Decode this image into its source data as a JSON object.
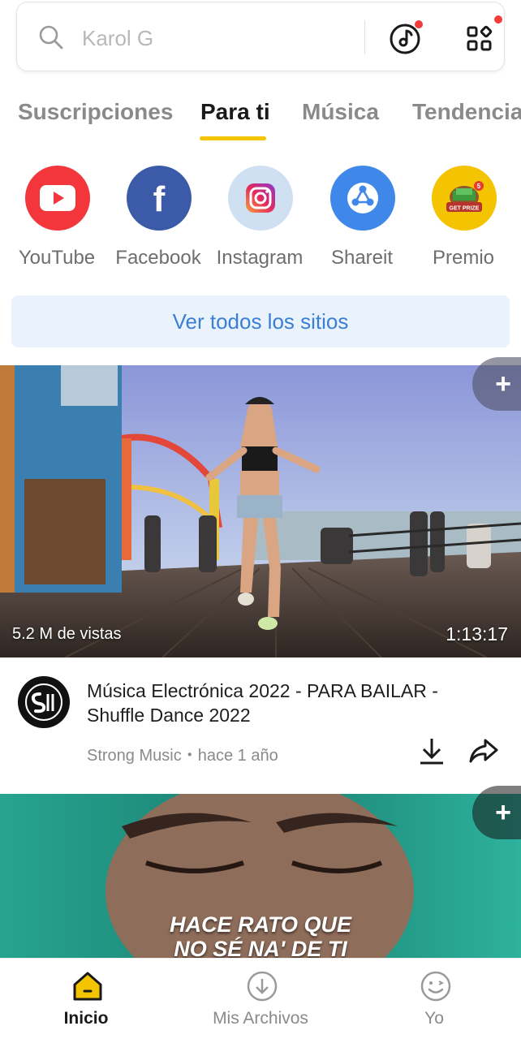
{
  "search": {
    "placeholder": "Karol G"
  },
  "tabs": [
    {
      "label": "Suscripciones",
      "active": false
    },
    {
      "label": "Para ti",
      "active": true
    },
    {
      "label": "Música",
      "active": false
    },
    {
      "label": "Tendencia",
      "active": false
    }
  ],
  "sites": [
    {
      "label": "YouTube",
      "icon": "youtube-icon",
      "color": "#f2363b"
    },
    {
      "label": "Facebook",
      "icon": "facebook-icon",
      "color": "#3b5ba8"
    },
    {
      "label": "Instagram",
      "icon": "instagram-icon",
      "color": "#cfe0f3"
    },
    {
      "label": "Shareit",
      "icon": "shareit-icon",
      "color": "#3f87e8"
    },
    {
      "label": "Premio",
      "icon": "prize-icon",
      "color": "#f5c400"
    }
  ],
  "see_all_label": "Ver todos los sitios",
  "videos": [
    {
      "views": "5.2 M de vistas",
      "duration": "1:13:17",
      "title": "Música Electrónica 2022 - PARA BAILAR - Shuffle Dance 2022",
      "channel": "Strong Music",
      "age": "hace 1 año",
      "meta_separator": "・"
    },
    {
      "caption_line1": "HACE RATO QUE",
      "caption_line2": "NO SÉ NA' DE TI"
    }
  ],
  "bottom_nav": [
    {
      "label": "Inicio",
      "icon": "home-icon",
      "active": true
    },
    {
      "label": "Mis Archivos",
      "icon": "download-circle-icon",
      "active": false
    },
    {
      "label": "Yo",
      "icon": "smiley-icon",
      "active": false
    }
  ],
  "colors": {
    "accent": "#f5c400",
    "link_blue": "#3a7fd5",
    "notification_dot": "#f23b3b"
  }
}
